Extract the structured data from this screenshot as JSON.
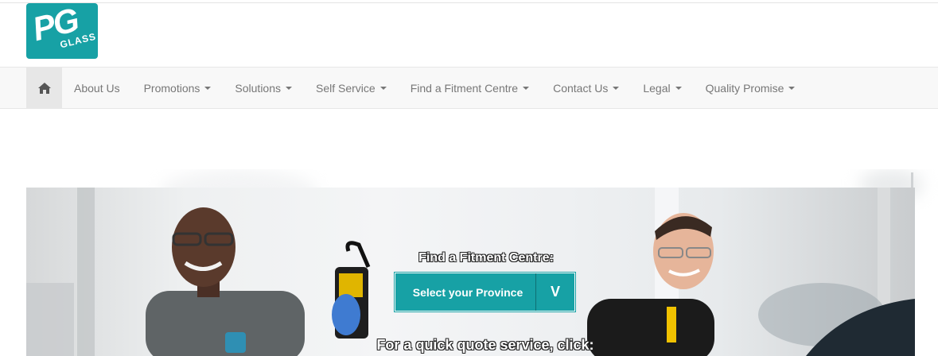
{
  "logo": {
    "pg": "PG",
    "glass": "GLASS"
  },
  "nav": {
    "home_icon": "home-icon",
    "items": [
      {
        "label": "About Us",
        "dropdown": false
      },
      {
        "label": "Promotions",
        "dropdown": true
      },
      {
        "label": "Solutions",
        "dropdown": true
      },
      {
        "label": "Self Service",
        "dropdown": true
      },
      {
        "label": "Find a Fitment Centre",
        "dropdown": true
      },
      {
        "label": "Contact Us",
        "dropdown": true
      },
      {
        "label": "Legal",
        "dropdown": true
      },
      {
        "label": "Quality Promise",
        "dropdown": true
      }
    ]
  },
  "hero": {
    "finder_title": "Find a Fitment Centre:",
    "province_label": "Select your Province",
    "province_arrow": "V",
    "quote_text": "For a quick quote service, click:"
  },
  "colors": {
    "brand": "#17a1a5",
    "nav_bg": "#f8f8f8",
    "nav_text": "#777777"
  }
}
